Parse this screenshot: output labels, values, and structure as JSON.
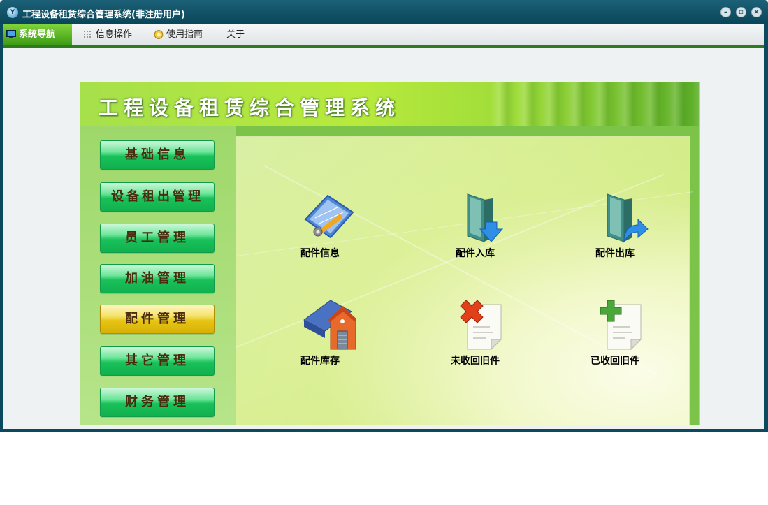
{
  "window": {
    "title": "工程设备租赁综合管理系统(非注册用户)",
    "app_icon_text": "Y"
  },
  "menubar": {
    "items": [
      {
        "label": "系统导航",
        "icon": "monitor-icon",
        "active": true
      },
      {
        "label": "信息操作",
        "icon": "grid-icon",
        "active": false
      },
      {
        "label": "使用指南",
        "icon": "help-icon",
        "active": false
      },
      {
        "label": "关于",
        "icon": "",
        "active": false
      }
    ]
  },
  "panel": {
    "title": "工程设备租赁综合管理系统"
  },
  "sidebar": {
    "items": [
      {
        "label": "基础信息",
        "active": false
      },
      {
        "label": "设备租出管理",
        "active": false
      },
      {
        "label": "员工管理",
        "active": false
      },
      {
        "label": "加油管理",
        "active": false
      },
      {
        "label": "配件管理",
        "active": true
      },
      {
        "label": "其它管理",
        "active": false
      },
      {
        "label": "财务管理",
        "active": false
      }
    ]
  },
  "content": {
    "tiles": [
      {
        "label": "配件信息",
        "icon": "blueprint-tools-icon"
      },
      {
        "label": "配件入库",
        "icon": "folder-download-icon"
      },
      {
        "label": "配件出库",
        "icon": "folder-export-icon"
      },
      {
        "label": "配件库存",
        "icon": "warehouse-icon"
      },
      {
        "label": "未收回旧件",
        "icon": "document-delete-icon"
      },
      {
        "label": "已收回旧件",
        "icon": "document-add-icon"
      }
    ]
  },
  "colors": {
    "title_bar": "#0b4a5e",
    "menu_active": "#3b9a14",
    "nav_button": "#19c15a",
    "nav_button_active": "#e7c514",
    "panel_green": "#7cc34a"
  }
}
